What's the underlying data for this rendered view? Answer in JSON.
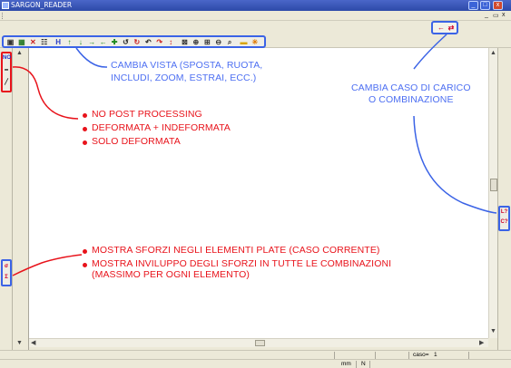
{
  "window": {
    "title": "SARGON_READER",
    "minimize_glyph": "_",
    "maximize_glyph": "□",
    "close_glyph": "x"
  },
  "menubar": {
    "mdi_minimize": "_",
    "mdi_restore": "▭",
    "mdi_close": "x"
  },
  "case_icons": [
    "←",
    "⇄"
  ],
  "toolbar": {
    "buttons": [
      {
        "icon": "view-frame-icon",
        "glyph": "▣",
        "color": "#333333"
      },
      {
        "icon": "view-grid-icon",
        "glyph": "▦",
        "color": "#2a7a2a"
      },
      {
        "icon": "view-beam-icon",
        "glyph": "✕",
        "color": "#cc2222"
      },
      {
        "icon": "view-table-icon",
        "glyph": "☷",
        "color": "#333333"
      },
      {
        "icon": "move-horizontal-icon",
        "glyph": "H",
        "color": "#2b3fc8"
      },
      {
        "icon": "arrow-up-icon",
        "glyph": "↑",
        "color": "#1f8a1f"
      },
      {
        "icon": "arrow-down-icon",
        "glyph": "↓",
        "color": "#1f8a1f"
      },
      {
        "icon": "arrow-right-icon",
        "glyph": "→",
        "color": "#1f8a1f"
      },
      {
        "icon": "arrow-left-icon",
        "glyph": "←",
        "color": "#1f8a1f"
      },
      {
        "icon": "center-icon",
        "glyph": "✚",
        "color": "#1f8a1f"
      },
      {
        "icon": "rotate-left-icon",
        "glyph": "↺",
        "color": "#222222"
      },
      {
        "icon": "rotate-right-icon",
        "glyph": "↻",
        "color": "#cc2222"
      },
      {
        "icon": "rotate-up-icon",
        "glyph": "↶",
        "color": "#222222"
      },
      {
        "icon": "rotate-down-icon",
        "glyph": "↷",
        "color": "#cc2222"
      },
      {
        "icon": "rotate-z-icon",
        "glyph": "↕",
        "color": "#cc2222"
      },
      {
        "icon": "zoom-window-icon",
        "glyph": "⊠",
        "color": "#333333"
      },
      {
        "icon": "zoom-in-icon",
        "glyph": "⊕",
        "color": "#333333"
      },
      {
        "icon": "zoom-all-icon",
        "glyph": "⊞",
        "color": "#333333"
      },
      {
        "icon": "zoom-out-icon",
        "glyph": "⊖",
        "color": "#333333"
      },
      {
        "icon": "zoom-extents-icon",
        "glyph": "⌕",
        "color": "#333333"
      },
      {
        "icon": "open-folder-icon",
        "glyph": "▬",
        "color": "#d8a400"
      },
      {
        "icon": "extract-icon",
        "glyph": "✳",
        "color": "#e07a00"
      }
    ]
  },
  "left_panel": {
    "top_icons": [
      {
        "name": "no-post-processing-icon",
        "glyph": "NO",
        "color": "#1a33cc"
      },
      {
        "name": "deformed-undeformed-icon",
        "glyph": "━",
        "color": "#111111"
      },
      {
        "name": "deformed-only-icon",
        "glyph": "╱",
        "color": "#111111"
      }
    ],
    "bottom_icons": [
      {
        "name": "plate-stress-current-icon",
        "glyph": "σ"
      },
      {
        "name": "plate-stress-envelope-icon",
        "glyph": "Σ"
      }
    ]
  },
  "right_panel": {
    "icons": [
      {
        "name": "load-case-icon",
        "glyph": "L?"
      },
      {
        "name": "combination-icon",
        "glyph": "C?"
      }
    ]
  },
  "annotations": {
    "view_change": [
      "CAMBIA VISTA (SPOSTA, RUOTA,",
      "INCLUDI, ZOOM, ESTRAI, ECC.)"
    ],
    "load_case": [
      "CAMBIA CASO DI CARICO",
      "O COMBINAZIONE"
    ],
    "postprocess_options": [
      "NO POST PROCESSING",
      "DEFORMATA + INDEFORMATA",
      "SOLO DEFORMATA"
    ],
    "stress_options": [
      "MOSTRA SFORZI NEGLI ELEMENTI PLATE (CASO CORRENTE)",
      "MOSTRA INVILUPPO DEGLI SFORZI IN TUTTE LE COMBINAZIONI",
      "(MASSIMO PER OGNI ELEMENTO)"
    ]
  },
  "status": {
    "caso_label": "caso=",
    "caso_value": "1",
    "units": "mm",
    "force_unit": "N"
  },
  "colors": {
    "annotation_blue": "#4d6ff2",
    "annotation_red": "#e8131b",
    "titlebar": "#2d4aa8",
    "chrome": "#ece9d8"
  }
}
